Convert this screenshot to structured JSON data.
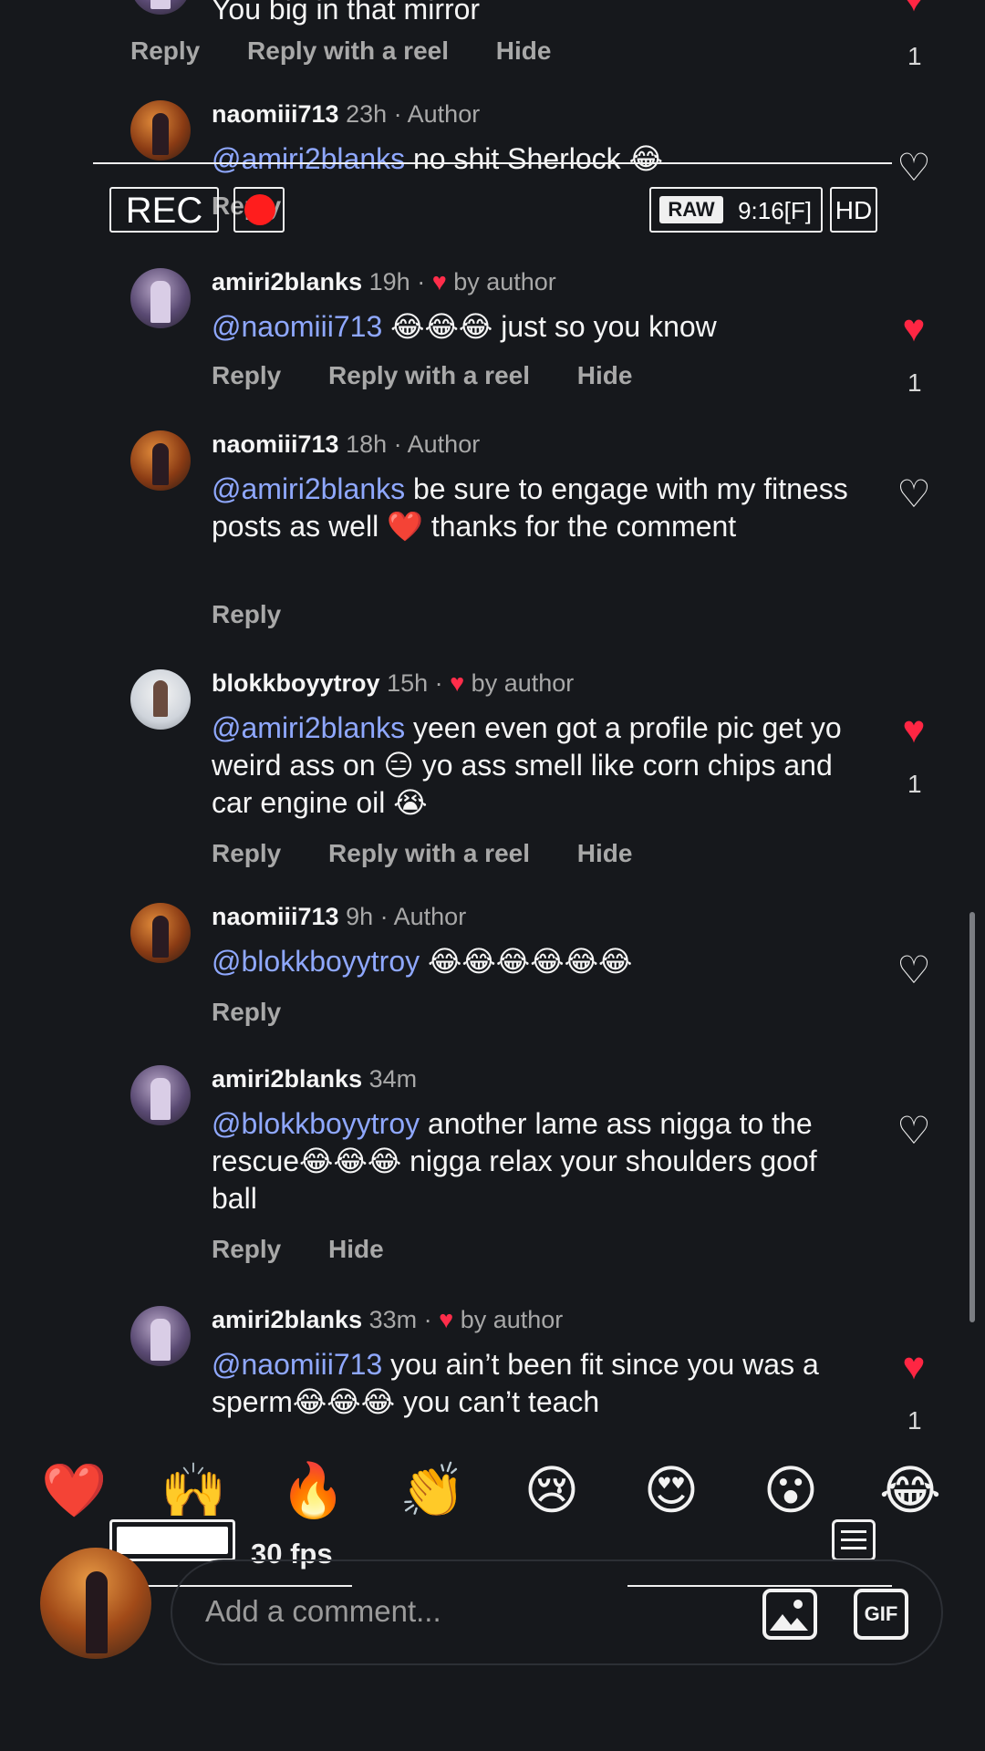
{
  "comments": [
    {
      "id": "top-partial",
      "body_text": "You big in that mirror",
      "actions": [
        "Reply",
        "Reply with a reel",
        "Hide"
      ],
      "liked": true,
      "like_count": "1"
    },
    {
      "username": "naomiii713",
      "time": "23h",
      "tag": "· Author",
      "mention": "@amiri2blanks",
      "text": " no shit Sherlock 😂",
      "actions": [
        "Reply"
      ],
      "liked": false
    },
    {
      "username": "amiri2blanks",
      "time": "19h",
      "tag": "· ",
      "tag_heart": "♥",
      "tag_suffix": " by author",
      "mention": "@naomiii713",
      "text": " 😂😂😂 just so you know",
      "actions": [
        "Reply",
        "Reply with a reel",
        "Hide"
      ],
      "liked": true,
      "like_count": "1"
    },
    {
      "username": "naomiii713",
      "time": "18h",
      "tag": "· Author",
      "mention": "@amiri2blanks",
      "text": " be sure to engage with my fitness posts as well ❤️ thanks for the comment",
      "actions": [
        "Reply"
      ],
      "liked": false
    },
    {
      "username": "blokkboyytroy",
      "time": "15h",
      "tag": "· ",
      "tag_heart": "♥",
      "tag_suffix": " by author",
      "mention": "@amiri2blanks",
      "text": " yeen even got a profile pic get yo weird ass on 😑 yo ass smell like corn chips and car engine oil 😭",
      "actions": [
        "Reply",
        "Reply with a reel",
        "Hide"
      ],
      "liked": true,
      "like_count": "1"
    },
    {
      "username": "naomiii713",
      "time": "9h",
      "tag": "· Author",
      "mention": "@blokkboyytroy",
      "text": " 😂😂😂😂😂😂",
      "actions": [
        "Reply"
      ],
      "liked": false
    },
    {
      "username": "amiri2blanks",
      "time": "34m",
      "tag": "",
      "mention": "@blokkboyytroy",
      "text": " another lame ass nigga to the rescue😂😂😂 nigga relax your shoulders goof ball",
      "actions": [
        "Reply",
        "Hide"
      ],
      "liked": false
    },
    {
      "username": "amiri2blanks",
      "time": "33m",
      "tag": "· ",
      "tag_heart": "♥",
      "tag_suffix": " by author",
      "mention": "@naomiii713",
      "text": " you ain’t been fit since you was a sperm😂😂😂 you can’t teach",
      "liked": true,
      "like_count": "1"
    }
  ],
  "overlay": {
    "rec_label": "REC",
    "raw_label": "RAW",
    "aspect_label": "9:16[F]",
    "hd_label": "HD",
    "fps_label": "30 fps"
  },
  "reactions": [
    "❤️",
    "🙌",
    "🔥",
    "👏",
    "😢",
    "😍",
    "😮",
    "😂"
  ],
  "composer": {
    "placeholder": "Add a comment...",
    "gif_label": "GIF"
  },
  "icons": {
    "like_filled": "heart-filled-icon",
    "like_outline": "heart-outline-icon",
    "gallery": "image-icon",
    "gif": "gif-icon",
    "list": "list-icon"
  },
  "colors": {
    "background": "#16181c",
    "mention": "#8fa8ff",
    "like_red": "#ff2643",
    "rec_red": "#ff1d1d"
  }
}
